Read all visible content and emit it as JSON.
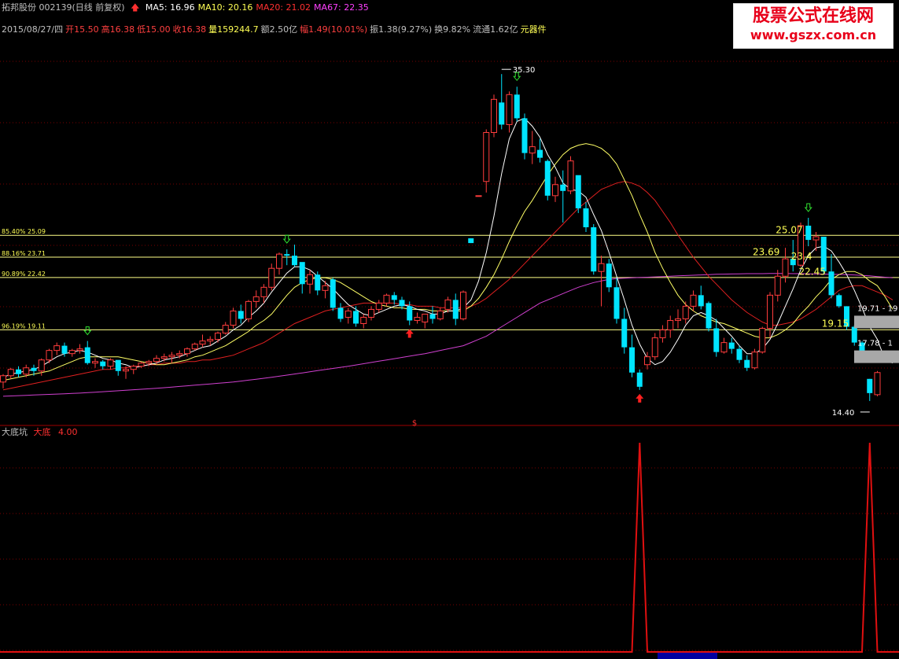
{
  "header": {
    "stock": "拓邦股份 002139(日线 前复权)",
    "ma": [
      {
        "label": "MA5: 16.96",
        "color": "#ffffff"
      },
      {
        "label": "MA10: 20.16",
        "color": "#ffff55"
      },
      {
        "label": "MA20: 21.02",
        "color": "#ff3030"
      },
      {
        "label": "MA67: 22.35",
        "color": "#ff40ff"
      }
    ],
    "info": [
      {
        "t": "2015/08/27/四",
        "c": "#c0c0c0"
      },
      {
        "t": "开15.50",
        "c": "#ff4040"
      },
      {
        "t": "高16.38",
        "c": "#ff4040"
      },
      {
        "t": "低15.00",
        "c": "#ff4040"
      },
      {
        "t": "收16.38",
        "c": "#ff4040"
      },
      {
        "t": "量159244.7",
        "c": "#ffff55"
      },
      {
        "t": "额2.50亿",
        "c": "#c0c0c0"
      },
      {
        "t": "幅1.49(10.01%)",
        "c": "#ff4040"
      },
      {
        "t": "振1.38(9.27%)",
        "c": "#c0c0c0"
      },
      {
        "t": "换9.82%",
        "c": "#c0c0c0"
      },
      {
        "t": "流通1.62亿",
        "c": "#c0c0c0"
      },
      {
        "t": "元器件",
        "c": "#ffff55"
      }
    ]
  },
  "watermark": {
    "line1": "股票公式在线网",
    "line2": "www.gszx.com.cn"
  },
  "indicator": {
    "name": "大底坑",
    "series": "大底",
    "value": "4.00"
  },
  "colors": {
    "up": "#ff3c3c",
    "down": "#00e4ff",
    "ma5": "#ffffff",
    "ma10": "#ffff66",
    "ma20": "#e02020",
    "ma67": "#d040d0",
    "hline": "#ffff88",
    "grid": "#7a0000",
    "signal": "#e01010",
    "label": "#ffff55"
  },
  "chart_data": {
    "type": "candlestick",
    "price_range": [
      13.5,
      37.5
    ],
    "candles": [
      [
        15.8,
        16.3,
        15.4,
        16.2
      ],
      [
        16.2,
        16.7,
        16.0,
        16.6
      ],
      [
        16.6,
        16.8,
        16.1,
        16.3
      ],
      [
        16.3,
        16.9,
        16.1,
        16.7
      ],
      [
        16.7,
        16.9,
        16.2,
        16.5
      ],
      [
        16.5,
        17.3,
        16.2,
        17.2
      ],
      [
        17.2,
        17.9,
        17.0,
        17.8
      ],
      [
        17.8,
        18.3,
        17.5,
        18.1
      ],
      [
        18.1,
        18.3,
        17.4,
        17.6
      ],
      [
        17.6,
        17.9,
        17.4,
        17.8
      ],
      [
        17.8,
        18.2,
        17.6,
        17.9
      ],
      [
        18.0,
        18.4,
        16.9,
        17.0
      ],
      [
        17.0,
        17.3,
        16.7,
        17.1
      ],
      [
        17.1,
        17.2,
        16.6,
        16.8
      ],
      [
        16.8,
        17.3,
        16.6,
        17.2
      ],
      [
        17.2,
        16.9,
        16.2,
        16.5
      ],
      [
        16.5,
        16.8,
        16.0,
        16.6
      ],
      [
        16.6,
        16.9,
        16.3,
        16.8
      ],
      [
        16.8,
        17.1,
        16.7,
        17.0
      ],
      [
        17.0,
        17.2,
        16.8,
        17.1
      ],
      [
        17.1,
        17.5,
        16.9,
        17.3
      ],
      [
        17.3,
        17.6,
        17.1,
        17.4
      ],
      [
        17.4,
        17.7,
        17.0,
        17.5
      ],
      [
        17.5,
        17.8,
        17.3,
        17.6
      ],
      [
        17.6,
        18.0,
        17.4,
        17.9
      ],
      [
        17.9,
        18.3,
        17.8,
        18.2
      ],
      [
        18.2,
        18.8,
        18.0,
        18.4
      ],
      [
        18.4,
        18.7,
        18.1,
        18.5
      ],
      [
        18.5,
        19.0,
        18.3,
        18.9
      ],
      [
        18.9,
        19.6,
        18.8,
        19.4
      ],
      [
        19.4,
        20.5,
        19.2,
        20.3
      ],
      [
        20.3,
        20.7,
        19.5,
        19.8
      ],
      [
        19.8,
        21.0,
        19.6,
        20.9
      ],
      [
        20.9,
        21.6,
        20.5,
        21.2
      ],
      [
        21.2,
        22.0,
        20.8,
        21.8
      ],
      [
        21.8,
        23.3,
        21.6,
        23.0
      ],
      [
        23.0,
        24.0,
        22.6,
        23.9
      ],
      [
        23.9,
        24.2,
        23.2,
        23.8
      ],
      [
        23.8,
        24.5,
        23.1,
        23.2
      ],
      [
        23.4,
        23.2,
        21.4,
        22.0
      ],
      [
        22.0,
        22.9,
        21.4,
        22.6
      ],
      [
        22.6,
        22.8,
        21.3,
        21.6
      ],
      [
        21.6,
        22.2,
        21.1,
        21.9
      ],
      [
        22.3,
        22.4,
        20.3,
        20.5
      ],
      [
        20.5,
        20.8,
        19.6,
        19.8
      ],
      [
        19.9,
        20.5,
        19.5,
        20.3
      ],
      [
        20.3,
        20.6,
        19.3,
        19.5
      ],
      [
        19.5,
        20.1,
        19.2,
        19.9
      ],
      [
        19.9,
        20.6,
        19.7,
        20.4
      ],
      [
        20.4,
        21.0,
        20.2,
        20.8
      ],
      [
        20.8,
        21.4,
        20.6,
        21.3
      ],
      [
        21.3,
        21.5,
        20.7,
        21.0
      ],
      [
        21.0,
        21.2,
        20.4,
        20.6
      ],
      [
        20.6,
        20.9,
        19.4,
        19.7
      ],
      [
        19.7,
        20.2,
        19.5,
        19.9
      ],
      [
        19.6,
        20.0,
        19.2,
        20.1
      ],
      [
        20.1,
        20.6,
        19.5,
        19.8
      ],
      [
        19.8,
        20.5,
        19.7,
        20.3
      ],
      [
        20.4,
        21.2,
        20.2,
        21.0
      ],
      [
        21.0,
        21.4,
        19.4,
        19.8
      ],
      [
        19.8,
        21.6,
        19.7,
        21.5
      ],
      [
        24.9,
        24.9,
        24.6,
        24.6
      ],
      [
        27.6,
        27.6,
        27.6,
        27.6
      ],
      [
        28.5,
        31.8,
        27.8,
        31.6
      ],
      [
        31.6,
        34.0,
        31.3,
        33.7
      ],
      [
        33.5,
        35.3,
        31.8,
        32.1
      ],
      [
        32.1,
        34.2,
        31.6,
        34.0
      ],
      [
        34.0,
        34.5,
        32.3,
        32.5
      ],
      [
        32.5,
        32.8,
        29.9,
        30.3
      ],
      [
        30.3,
        31.7,
        29.6,
        30.7
      ],
      [
        30.5,
        31.2,
        29.7,
        30.0
      ],
      [
        29.8,
        29.9,
        27.3,
        27.6
      ],
      [
        27.6,
        28.8,
        27.2,
        28.3
      ],
      [
        28.3,
        29.2,
        25.9,
        27.9
      ],
      [
        27.9,
        30.1,
        27.7,
        29.8
      ],
      [
        28.9,
        28.1,
        26.5,
        26.8
      ],
      [
        26.8,
        27.2,
        25.3,
        25.6
      ],
      [
        25.6,
        25.8,
        22.6,
        22.8
      ],
      [
        22.8,
        23.8,
        20.6,
        23.3
      ],
      [
        23.3,
        23.6,
        21.5,
        21.8
      ],
      [
        21.8,
        22.4,
        19.5,
        19.8
      ],
      [
        19.8,
        20.5,
        17.6,
        18.0
      ],
      [
        18.0,
        18.8,
        16.1,
        16.4
      ],
      [
        16.4,
        16.6,
        15.3,
        15.5
      ],
      [
        16.9,
        17.7,
        16.6,
        17.4
      ],
      [
        17.4,
        18.9,
        17.2,
        18.6
      ],
      [
        18.6,
        19.4,
        18.3,
        19.1
      ],
      [
        19.1,
        20.0,
        18.6,
        19.7
      ],
      [
        19.7,
        20.4,
        19.2,
        19.8
      ],
      [
        19.8,
        20.9,
        19.5,
        20.6
      ],
      [
        20.6,
        21.6,
        20.3,
        21.3
      ],
      [
        21.3,
        21.9,
        20.4,
        20.6
      ],
      [
        20.8,
        20.9,
        19.0,
        19.2
      ],
      [
        19.2,
        19.8,
        17.4,
        17.7
      ],
      [
        17.7,
        18.6,
        17.6,
        18.3
      ],
      [
        18.3,
        18.6,
        17.6,
        17.9
      ],
      [
        17.9,
        18.1,
        17.0,
        17.2
      ],
      [
        17.2,
        17.5,
        16.5,
        16.7
      ],
      [
        16.7,
        17.9,
        16.6,
        17.7
      ],
      [
        17.7,
        19.3,
        17.6,
        19.2
      ],
      [
        19.2,
        21.5,
        18.6,
        21.3
      ],
      [
        21.3,
        22.9,
        20.9,
        22.5
      ],
      [
        22.5,
        24.3,
        22.1,
        23.6
      ],
      [
        23.6,
        24.8,
        22.8,
        23.2
      ],
      [
        23.2,
        25.9,
        23.1,
        25.7
      ],
      [
        25.7,
        26.2,
        24.4,
        24.8
      ],
      [
        24.8,
        25.3,
        24.1,
        25.0
      ],
      [
        25.0,
        25.0,
        22.6,
        22.8
      ],
      [
        22.8,
        23.9,
        21.1,
        21.3
      ],
      [
        21.3,
        21.4,
        20.5,
        20.6
      ],
      [
        20.6,
        20.6,
        19.1,
        19.3
      ],
      [
        19.3,
        19.4,
        18.1,
        18.3
      ],
      [
        18.3,
        18.4,
        17.1,
        17.3
      ],
      [
        16.0,
        16.0,
        14.6,
        15.1
      ],
      [
        15.0,
        16.5,
        14.9,
        16.4
      ]
    ],
    "ma5": [
      16.1,
      16.3,
      16.4,
      16.5,
      16.6,
      16.8,
      17.1,
      17.4,
      17.6,
      17.7,
      17.8,
      17.7,
      17.5,
      17.3,
      17.2,
      17.0,
      16.9,
      16.7,
      16.8,
      16.9,
      17.0,
      17.2,
      17.3,
      17.4,
      17.6,
      17.8,
      18.0,
      18.1,
      18.4,
      18.7,
      19.1,
      19.4,
      19.9,
      20.3,
      20.8,
      21.5,
      22.1,
      22.7,
      23.1,
      23.1,
      22.9,
      22.5,
      22.1,
      21.7,
      21.2,
      20.7,
      20.4,
      20.1,
      20.0,
      20.2,
      20.4,
      20.6,
      20.7,
      20.6,
      20.4,
      20.3,
      20.1,
      20.1,
      20.3,
      20.3,
      20.5,
      21.0,
      22.2,
      24.0,
      26.3,
      29.0,
      31.2,
      32.3,
      32.5,
      32.0,
      31.3,
      30.2,
      29.4,
      28.4,
      28.0,
      27.9,
      27.5,
      26.4,
      25.4,
      24.0,
      22.5,
      21.0,
      19.4,
      18.2,
      17.3,
      16.9,
      17.1,
      17.7,
      18.5,
      19.4,
      20.0,
      20.2,
      20.0,
      19.7,
      19.2,
      18.7,
      18.1,
      17.6,
      17.6,
      17.9,
      18.5,
      19.5,
      20.6,
      21.7,
      22.9,
      23.8,
      24.3,
      24.4,
      24.1,
      23.4,
      22.6,
      21.6,
      20.5,
      19.3,
      18.5,
      17.2,
      17.0
    ],
    "ma10": [
      15.9,
      16.0,
      16.1,
      16.2,
      16.3,
      16.4,
      16.5,
      16.7,
      16.9,
      17.1,
      17.3,
      17.4,
      17.4,
      17.4,
      17.4,
      17.4,
      17.3,
      17.2,
      17.1,
      17.0,
      16.9,
      16.9,
      17.0,
      17.1,
      17.2,
      17.4,
      17.5,
      17.7,
      17.9,
      18.1,
      18.4,
      18.7,
      19.0,
      19.4,
      19.7,
      20.1,
      20.7,
      21.3,
      21.8,
      22.1,
      22.3,
      22.4,
      22.4,
      22.3,
      22.1,
      21.8,
      21.5,
      21.2,
      20.9,
      20.7,
      20.6,
      20.5,
      20.5,
      20.4,
      20.4,
      20.4,
      20.3,
      20.3,
      20.3,
      20.3,
      20.3,
      20.6,
      21.1,
      21.8,
      22.6,
      23.6,
      24.7,
      25.7,
      26.6,
      27.3,
      28.1,
      28.9,
      29.6,
      30.2,
      30.6,
      30.8,
      30.9,
      30.8,
      30.6,
      30.2,
      29.6,
      28.6,
      27.6,
      26.4,
      25.3,
      24.0,
      23.0,
      22.1,
      21.3,
      20.7,
      20.3,
      20.0,
      19.8,
      19.6,
      19.5,
      19.3,
      19.1,
      18.9,
      18.7,
      18.6,
      18.6,
      18.8,
      19.1,
      19.5,
      20.1,
      20.6,
      21.2,
      21.7,
      22.3,
      22.6,
      22.8,
      22.8,
      22.6,
      22.2,
      21.9,
      21.2,
      20.4
    ],
    "ma20": [
      15.3,
      15.4,
      15.5,
      15.6,
      15.7,
      15.8,
      15.9,
      16.0,
      16.1,
      16.2,
      16.3,
      16.4,
      16.5,
      16.6,
      16.6,
      16.7,
      16.7,
      16.8,
      16.8,
      16.9,
      16.9,
      17.0,
      17.0,
      17.0,
      17.1,
      17.1,
      17.2,
      17.2,
      17.3,
      17.4,
      17.5,
      17.7,
      17.9,
      18.1,
      18.3,
      18.6,
      18.9,
      19.2,
      19.5,
      19.7,
      19.9,
      20.1,
      20.3,
      20.4,
      20.5,
      20.6,
      20.7,
      20.8,
      20.8,
      20.8,
      20.8,
      20.8,
      20.7,
      20.7,
      20.6,
      20.6,
      20.6,
      20.5,
      20.5,
      20.5,
      20.5,
      20.6,
      20.8,
      21.1,
      21.5,
      21.9,
      22.3,
      22.8,
      23.3,
      23.8,
      24.3,
      24.8,
      25.3,
      25.8,
      26.3,
      26.8,
      27.2,
      27.6,
      28.0,
      28.2,
      28.4,
      28.5,
      28.4,
      28.2,
      27.8,
      27.3,
      26.6,
      25.9,
      25.1,
      24.4,
      23.7,
      23.1,
      22.5,
      22.0,
      21.5,
      21.0,
      20.6,
      20.2,
      19.9,
      19.6,
      19.4,
      19.4,
      19.5,
      19.6,
      19.8,
      20.1,
      20.4,
      20.8,
      21.2,
      21.6,
      21.8,
      21.9,
      21.9,
      21.7,
      21.5,
      21.3,
      21.0
    ],
    "ma67": [
      14.9,
      14.92,
      14.94,
      14.96,
      14.98,
      15.0,
      15.02,
      15.04,
      15.06,
      15.08,
      15.1,
      15.13,
      15.16,
      15.19,
      15.22,
      15.25,
      15.28,
      15.31,
      15.34,
      15.37,
      15.4,
      15.44,
      15.48,
      15.52,
      15.56,
      15.6,
      15.64,
      15.68,
      15.72,
      15.76,
      15.8,
      15.86,
      15.92,
      15.98,
      16.04,
      16.1,
      16.17,
      16.24,
      16.31,
      16.38,
      16.45,
      16.52,
      16.59,
      16.66,
      16.73,
      16.8,
      16.88,
      16.96,
      17.04,
      17.12,
      17.2,
      17.28,
      17.36,
      17.44,
      17.52,
      17.6,
      17.7,
      17.8,
      17.9,
      18.0,
      18.1,
      18.3,
      18.5,
      18.7,
      19.0,
      19.3,
      19.6,
      19.9,
      20.2,
      20.5,
      20.8,
      21.0,
      21.2,
      21.4,
      21.6,
      21.8,
      21.95,
      22.1,
      22.2,
      22.3,
      22.35,
      22.38,
      22.4,
      22.42,
      22.44,
      22.46,
      22.48,
      22.5,
      22.52,
      22.54,
      22.56,
      22.58,
      22.6,
      22.62,
      22.63,
      22.64,
      22.65,
      22.66,
      22.66,
      22.66,
      22.67,
      22.67,
      22.67,
      22.66,
      22.66,
      22.65,
      22.64,
      22.63,
      22.62,
      22.61,
      22.6,
      22.58,
      22.55,
      22.52,
      22.48,
      22.44,
      22.4
    ],
    "hlines": [
      {
        "price": 25.09,
        "label": "85.40% 25.09"
      },
      {
        "price": 23.71,
        "label": "88.16% 23.71"
      },
      {
        "price": 22.42,
        "label": "90.89% 22.42"
      },
      {
        "price": 19.11,
        "label": "96.19% 19.11"
      }
    ],
    "annotations": [
      {
        "i": 65,
        "price": 35.3,
        "text": "35.30",
        "dir": "right"
      },
      {
        "i": 113,
        "price": 14.4,
        "text": "14.40",
        "dir": "left"
      }
    ],
    "level_labels": [
      {
        "i": 103,
        "price": 25.07,
        "text": "25.07"
      },
      {
        "i": 100,
        "price": 23.69,
        "text": "23.69"
      },
      {
        "i": 105,
        "price": 23.4,
        "text": "23.4"
      },
      {
        "i": 106,
        "price": 22.45,
        "text": "22.45"
      },
      {
        "i": 109,
        "price": 19.15,
        "text": "19.15"
      }
    ],
    "edge_labels": [
      {
        "price": 20.3,
        "text": "19.71 - 19"
      },
      {
        "price": 18.1,
        "text": "17.78 - 1"
      }
    ],
    "up_arrows": [
      53,
      83
    ],
    "down_arrows": [
      11,
      37,
      67,
      105
    ],
    "indicator_series": {
      "name": "大底",
      "spikes": [
        83,
        113
      ],
      "max": 4.0
    }
  }
}
